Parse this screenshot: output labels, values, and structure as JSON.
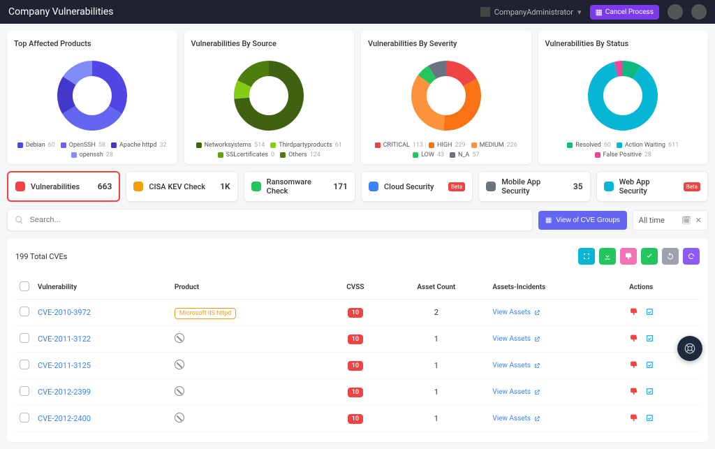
{
  "header": {
    "title": "Company Vulnerabilities",
    "company_label": "CompanyAdministrator",
    "create_label": "Cancel Process"
  },
  "charts": [
    {
      "title": "Top Affected Products",
      "chart_data": {
        "type": "pie",
        "series": [
          {
            "name": "Debian",
            "value": 60,
            "color": "#4f46e5"
          },
          {
            "name": "OpenSSH",
            "value": 58,
            "color": "#6366f1"
          },
          {
            "name": "Apache httpd",
            "value": 32,
            "color": "#4338ca"
          },
          {
            "name": "openssh",
            "value": 28,
            "color": "#818cf8"
          }
        ]
      }
    },
    {
      "title": "Vulnerabilities By Source",
      "chart_data": {
        "type": "pie",
        "series": [
          {
            "name": "Networksystems",
            "value": 514,
            "color": "#3f6212"
          },
          {
            "name": "Thirdpartyproducts",
            "value": 61,
            "color": "#84cc16"
          },
          {
            "name": "SSLcertificates",
            "value": 0,
            "color": "#65a30d"
          },
          {
            "name": "Others",
            "value": 124,
            "color": "#4d7c0f"
          }
        ]
      }
    },
    {
      "title": "Vulnerabilities By Severity",
      "chart_data": {
        "type": "pie",
        "series": [
          {
            "name": "CRITICAL",
            "value": 113,
            "color": "#ef4444"
          },
          {
            "name": "HIGH",
            "value": 229,
            "color": "#f97316"
          },
          {
            "name": "MEDIUM",
            "value": 226,
            "color": "#fb923c"
          },
          {
            "name": "LOW",
            "value": 43,
            "color": "#22c55e"
          },
          {
            "name": "N_A",
            "value": 57,
            "color": "#6b7280"
          }
        ]
      }
    },
    {
      "title": "Vulnerabilities By Status",
      "chart_data": {
        "type": "pie",
        "series": [
          {
            "name": "Resolved",
            "value": 60,
            "color": "#10b981"
          },
          {
            "name": "Action Waiting",
            "value": 611,
            "color": "#06b6d4"
          },
          {
            "name": "False Positive",
            "value": 28,
            "color": "#ec4899"
          }
        ]
      }
    }
  ],
  "tabs": [
    {
      "label": "Vulnerabilities",
      "value": "663",
      "color": "#ef4444",
      "beta": false,
      "active": true
    },
    {
      "label": "CISA KEV Check",
      "value": "1K",
      "color": "#f59e0b",
      "beta": false,
      "active": false
    },
    {
      "label": "Ransomware Check",
      "value": "171",
      "color": "#22c55e",
      "beta": false,
      "active": false
    },
    {
      "label": "Cloud Security",
      "value": "",
      "color": "#3b82f6",
      "beta": true,
      "active": false
    },
    {
      "label": "Mobile App Security",
      "value": "35",
      "color": "#6b7280",
      "beta": false,
      "active": false
    },
    {
      "label": "Web App Security",
      "value": "",
      "color": "#06b6d4",
      "beta": true,
      "active": false
    }
  ],
  "filter": {
    "search_placeholder": "Search...",
    "cve_button": "View of CVE Groups",
    "time_label": "All time",
    "beta_label": "Beta"
  },
  "table": {
    "total": "199 Total CVEs",
    "columns": {
      "vulnerability": "Vulnerability",
      "product": "Product",
      "cvss": "CVSS",
      "asset_count": "Asset Count",
      "assets_incidents": "Assets-Incidents",
      "actions": "Actions"
    },
    "view_assets_label": "View Assets",
    "product_badge_label": "Microsoft IIS httpd",
    "rows": [
      {
        "cve": "CVE-2010-3972",
        "product": "badge",
        "cvss": "10",
        "asset_count": "2"
      },
      {
        "cve": "CVE-2011-3122",
        "product": "blocked",
        "cvss": "10",
        "asset_count": "1"
      },
      {
        "cve": "CVE-2011-3125",
        "product": "blocked",
        "cvss": "10",
        "asset_count": "1"
      },
      {
        "cve": "CVE-2012-2399",
        "product": "blocked",
        "cvss": "10",
        "asset_count": "1"
      },
      {
        "cve": "CVE-2012-2400",
        "product": "blocked",
        "cvss": "10",
        "asset_count": "1"
      }
    ]
  }
}
